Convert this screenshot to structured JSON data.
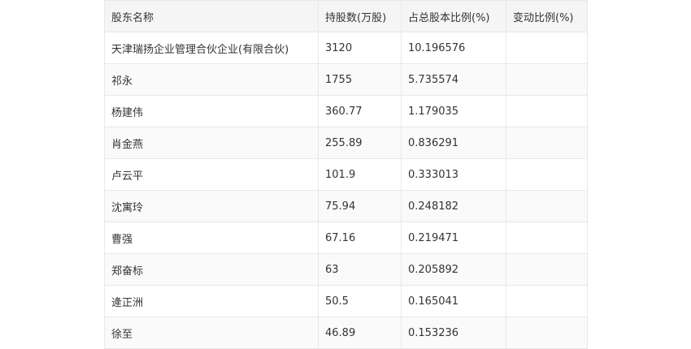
{
  "table": {
    "headers": [
      "股东名称",
      "持股数(万股)",
      "占总股本比例(%)",
      "变动比例(%)"
    ],
    "rows": [
      [
        "天津瑞扬企业管理合伙企业(有限合伙)",
        "3120",
        "10.196576",
        ""
      ],
      [
        "祁永",
        "1755",
        "5.735574",
        ""
      ],
      [
        "杨建伟",
        "360.77",
        "1.179035",
        ""
      ],
      [
        "肖金燕",
        "255.89",
        "0.836291",
        ""
      ],
      [
        "卢云平",
        "101.9",
        "0.333013",
        ""
      ],
      [
        "沈寓玲",
        "75.94",
        "0.248182",
        ""
      ],
      [
        "曹强",
        "67.16",
        "0.219471",
        ""
      ],
      [
        "郑奋标",
        "63",
        "0.205892",
        ""
      ],
      [
        "逄正洲",
        "50.5",
        "0.165041",
        ""
      ],
      [
        "徐至",
        "46.89",
        "0.153236",
        ""
      ]
    ]
  }
}
